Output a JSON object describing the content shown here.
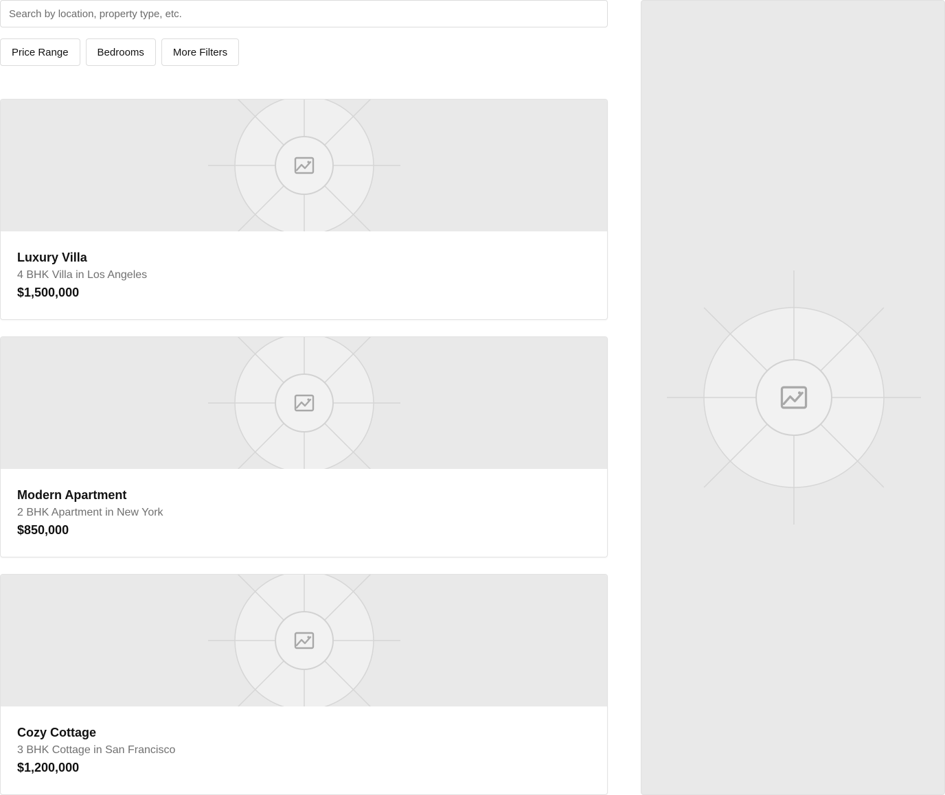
{
  "search": {
    "placeholder": "Search by location, property type, etc.",
    "value": ""
  },
  "filters": [
    {
      "label": "Price Range"
    },
    {
      "label": "Bedrooms"
    },
    {
      "label": "More Filters"
    }
  ],
  "listings": [
    {
      "title": "Luxury Villa",
      "subtitle": "4 BHK Villa in Los Angeles",
      "price": "$1,500,000",
      "image_icon": "image-placeholder-icon"
    },
    {
      "title": "Modern Apartment",
      "subtitle": "2 BHK Apartment in New York",
      "price": "$850,000",
      "image_icon": "image-placeholder-icon"
    },
    {
      "title": "Cozy Cottage",
      "subtitle": "3 BHK Cottage in San Francisco",
      "price": "$1,200,000",
      "image_icon": "image-placeholder-icon"
    }
  ],
  "map": {
    "icon": "image-placeholder-icon"
  },
  "colors": {
    "placeholder_bg": "#e9e9e9",
    "border": "#dcdcdc",
    "muted_text": "#707070"
  }
}
